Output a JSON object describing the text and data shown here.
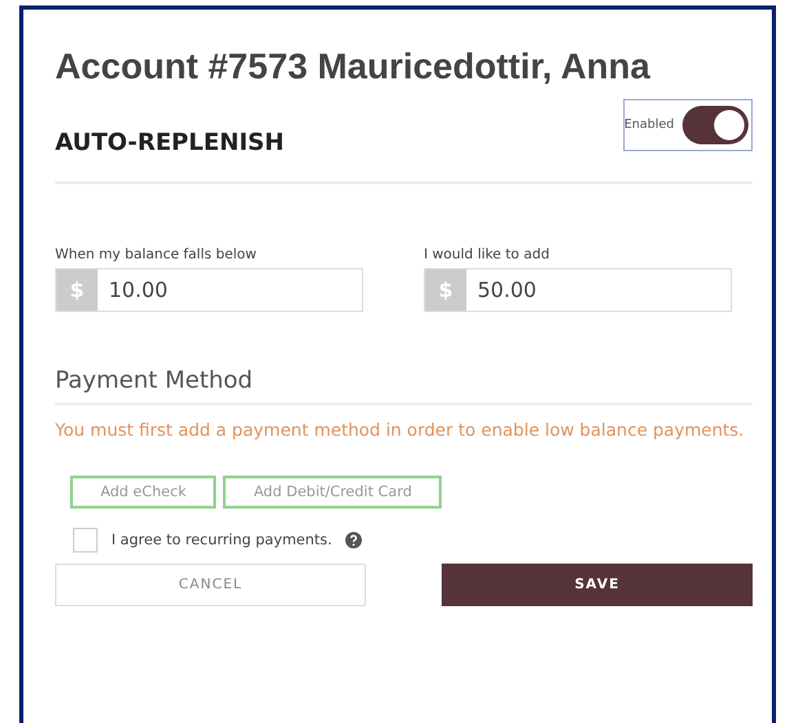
{
  "title": "Account #7573 Mauricedottir, Anna",
  "section": {
    "heading": "AUTO-REPLENISH",
    "toggle": {
      "label": "Enabled",
      "on": true
    }
  },
  "fields": [
    {
      "label": "When my balance falls below",
      "prefix": "$",
      "value": "10.00"
    },
    {
      "label": "I would like to add",
      "prefix": "$",
      "value": "50.00"
    }
  ],
  "payment": {
    "heading": "Payment Method",
    "warning": "You must first add a payment method in order to enable low balance payments.",
    "buttons": [
      "Add eCheck",
      "Add Debit/Credit Card"
    ]
  },
  "agree": {
    "label": "I agree to recurring payments.",
    "checked": false
  },
  "actions": [
    {
      "label": "CANCEL",
      "kind": "secondary"
    },
    {
      "label": "SAVE",
      "kind": "primary"
    }
  ]
}
